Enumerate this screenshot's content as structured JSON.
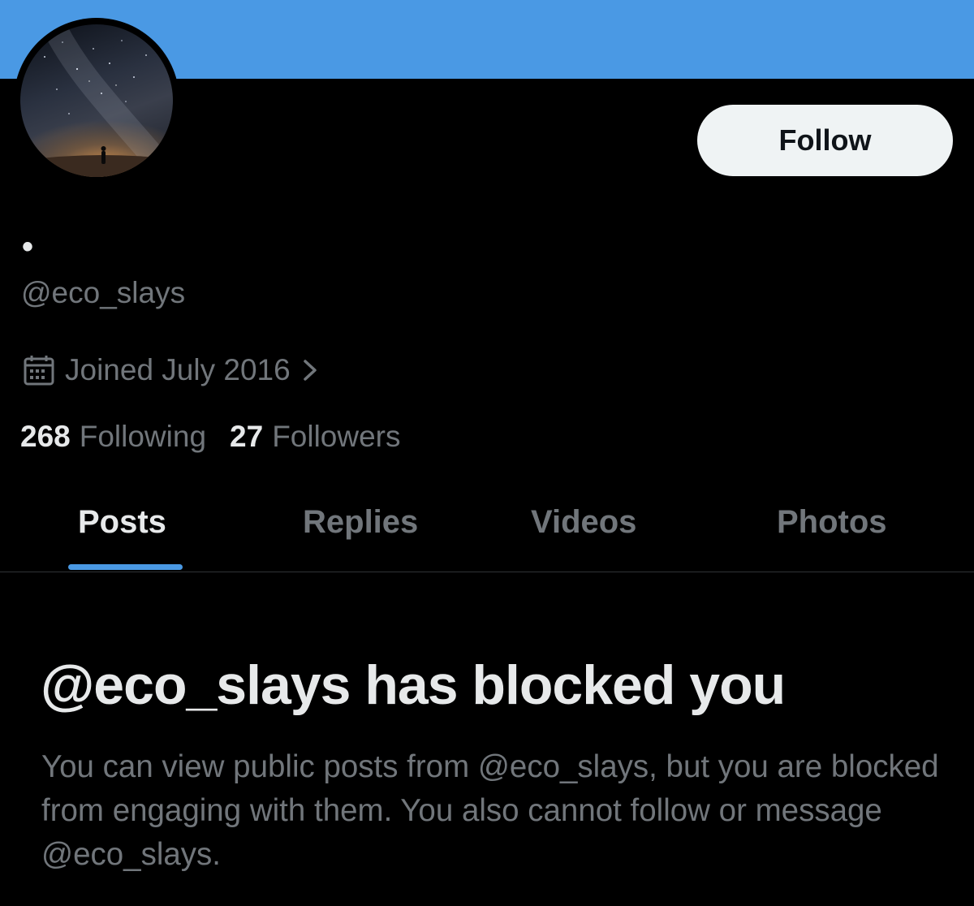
{
  "banner": {
    "color": "#4a99e4"
  },
  "profile": {
    "display_name": "•",
    "handle": "@eco_slays",
    "joined": "Joined July 2016",
    "following_count": "268",
    "following_label": "Following",
    "followers_count": "27",
    "followers_label": "Followers",
    "follow_button_label": "Follow"
  },
  "icons": {
    "calendar": "calendar-icon",
    "chevron": "chevron-right-icon"
  },
  "tabs": [
    {
      "label": "Posts",
      "active": true
    },
    {
      "label": "Replies",
      "active": false
    },
    {
      "label": "Videos",
      "active": false
    },
    {
      "label": "Photos",
      "active": false
    }
  ],
  "blocked": {
    "title": "@eco_slays has blocked you",
    "body": "You can view public posts from @eco_slays, but you are blocked from engaging with them. You also cannot follow or message @eco_slays."
  },
  "colors": {
    "accent": "#4a99e4",
    "background": "#000000",
    "primary_text": "#e7e9ea",
    "secondary_text": "#71767b"
  }
}
